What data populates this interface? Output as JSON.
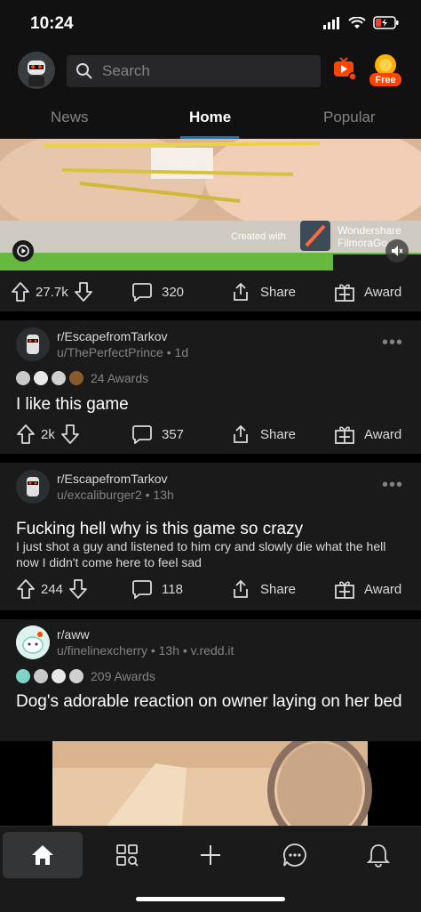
{
  "status": {
    "time": "10:24",
    "icons": [
      "signal-icon",
      "wifi-icon",
      "battery-icon"
    ]
  },
  "header": {
    "search_placeholder": "Search",
    "free_label": "Free"
  },
  "tabs": [
    {
      "label": "News"
    },
    {
      "label": "Home",
      "active": true
    },
    {
      "label": "Popular"
    }
  ],
  "media_post": {
    "watermark": "Created with",
    "brand_line1": "Wondershare",
    "brand_line2": "FilmoraGo",
    "votes": "27.7k",
    "comments": "320",
    "share_label": "Share",
    "award_label": "Award"
  },
  "posts": [
    {
      "subreddit": "r/EscapefromTarkov",
      "user": "u/ThePerfectPrince",
      "age": "1d",
      "awards": "24 Awards",
      "title": "I like this game",
      "votes": "2k",
      "comments": "357",
      "share_label": "Share",
      "award_label": "Award"
    },
    {
      "subreddit": "r/EscapefromTarkov",
      "user": "u/excaliburger2",
      "age": "13h",
      "title": "Fucking hell why is this game so crazy",
      "body": "I just shot a guy and listened to him cry and slowly die what the hell now I didn't come here to feel sad",
      "votes": "244",
      "comments": "118",
      "share_label": "Share",
      "award_label": "Award"
    },
    {
      "subreddit": "r/aww",
      "user": "u/finelinexcherry",
      "age": "13h",
      "domain": "v.redd.it",
      "awards": "209 Awards",
      "title": "Dog's adorable reaction on owner laying on her bed"
    }
  ],
  "bottom_nav": [
    "home-icon",
    "discover-icon",
    "create-icon",
    "chat-icon",
    "notifications-icon"
  ],
  "colors": {
    "background": "#000000",
    "card": "#1a1a1b",
    "accent": "#0079d3",
    "muted": "#818384"
  }
}
